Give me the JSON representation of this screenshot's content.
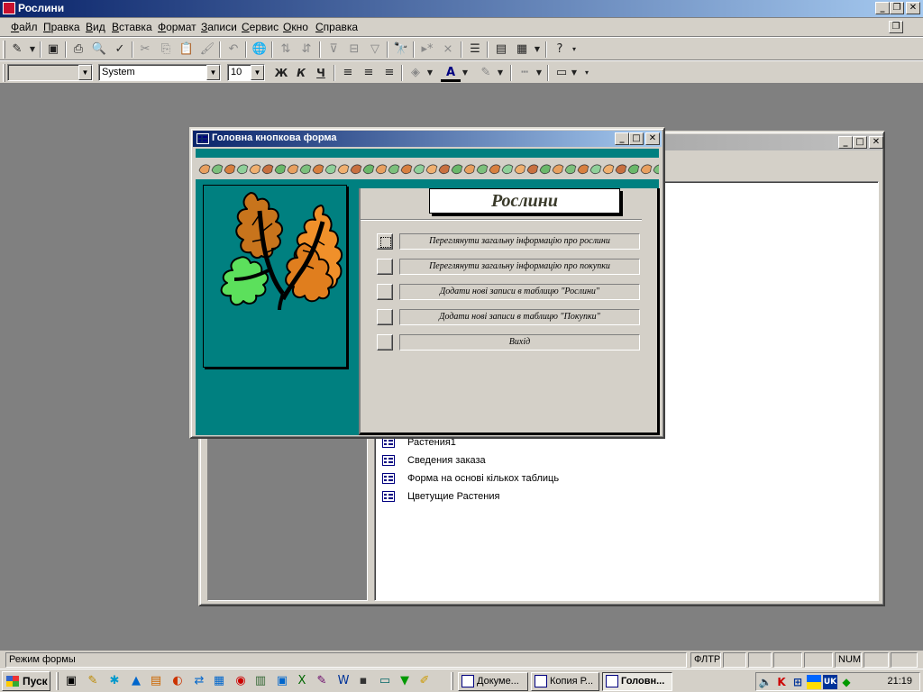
{
  "app": {
    "title": "Рослини"
  },
  "menu": [
    "Файл",
    "Правка",
    "Вид",
    "Вставка",
    "Формат",
    "Записи",
    "Сервис",
    "Окно",
    "Справка"
  ],
  "formatting": {
    "object_combo": "",
    "font": "System",
    "size": "10",
    "bold": "Ж",
    "italic": "К",
    "underline": "Ч"
  },
  "switchboard": {
    "title": "Головна кнопкова форма",
    "caption": "Рослини",
    "items": [
      "Переглянути загальну інформацію про рослини",
      "Переглянути загальну інформацію про покупки",
      "Додати нові записи в таблицю \"Рослини\"",
      "Додати нові записи в таблицю \"Покупки\"",
      "Вихід"
    ]
  },
  "db_window": {
    "items": [
      "Растения1",
      "Сведения заказа",
      "Форма на основі кількох таблиць",
      "Цветущие Растения"
    ]
  },
  "status": {
    "mode": "Режим формы",
    "filter": "ФЛТР",
    "num": "NUM"
  },
  "taskbar": {
    "start": "Пуск",
    "tasks": [
      "Докуме...",
      "Копия Р...",
      "Головн..."
    ],
    "clock": "21:19",
    "lang": "UK"
  },
  "colors": {
    "teal": "#008080",
    "titlebar": "#0a246a",
    "face": "#d4d0c8",
    "desktop": "#808080"
  }
}
